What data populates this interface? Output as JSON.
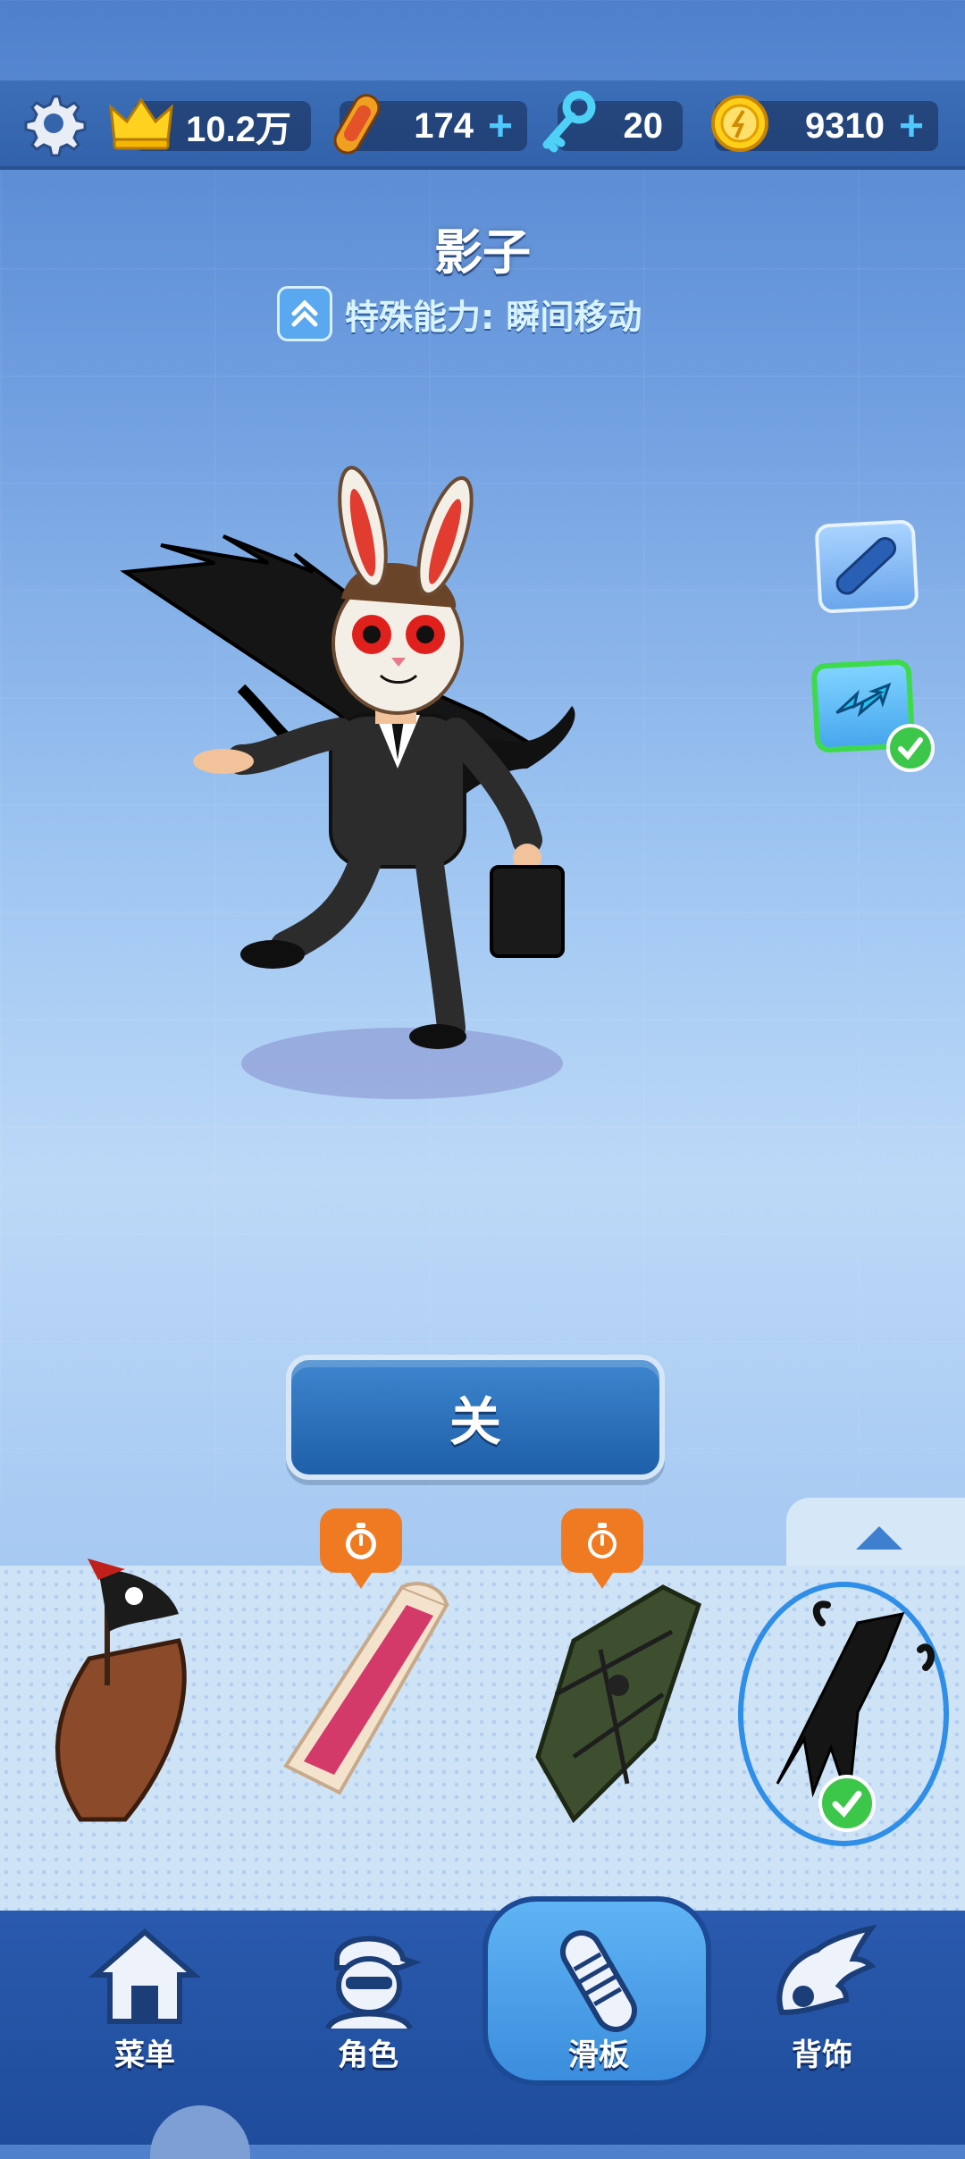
{
  "topbar": {
    "settings_icon": "gear-icon",
    "crown_icon": "crown-icon",
    "score": "10.2万",
    "board_icon": "hoverboard-icon",
    "boards": "174",
    "key_icon": "key-icon",
    "keys": "20",
    "coin_icon": "coin-icon",
    "coins": "9310",
    "plus": "+"
  },
  "character": {
    "name": "影子",
    "ability": "特殊能力: 瞬间移动"
  },
  "side_buttons": {
    "board_select_icon": "board-icon",
    "power_select_icon": "dash-power-icon"
  },
  "equip_button": {
    "label": "关"
  },
  "carousel": {
    "items": [
      {
        "name": "pirate-ship-board",
        "timed": false,
        "selected": false
      },
      {
        "name": "pink-slide-board",
        "timed": true,
        "selected": false
      },
      {
        "name": "coffin-board",
        "timed": true,
        "selected": false
      },
      {
        "name": "shadow-claw-board",
        "timed": false,
        "selected": true
      }
    ]
  },
  "nav": {
    "items": [
      {
        "label": "菜单",
        "icon": "home-icon"
      },
      {
        "label": "角色",
        "icon": "character-icon"
      },
      {
        "label": "滑板",
        "icon": "hoverboard-icon"
      },
      {
        "label": "背饰",
        "icon": "wings-icon"
      }
    ],
    "active_index": 2
  },
  "colors": {
    "accent_blue": "#1e5fa9",
    "check_green": "#3cc74a",
    "timer_orange": "#f07a22"
  }
}
